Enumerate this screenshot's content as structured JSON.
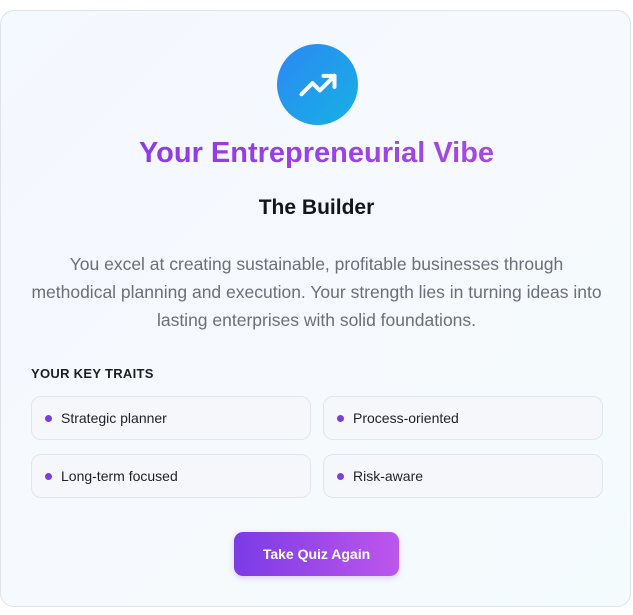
{
  "result": {
    "icon": "trending-up-icon",
    "title": "Your Entrepreneurial Vibe",
    "type_name": "The Builder",
    "description": "You excel at creating sustainable, profitable businesses through methodical planning and execution. Your strength lies in turning ideas into lasting enterprises with solid foundations."
  },
  "traits": {
    "heading": "YOUR KEY TRAITS",
    "items": [
      {
        "label": "Strategic planner"
      },
      {
        "label": "Process-oriented"
      },
      {
        "label": "Long-term focused"
      },
      {
        "label": "Risk-aware"
      }
    ]
  },
  "actions": {
    "retake_label": "Take Quiz Again"
  },
  "colors": {
    "accent_purple": "#8434e8",
    "accent_pink": "#bd56ec",
    "icon_blue": "#2c88f4",
    "icon_cyan": "#16b1e2"
  }
}
